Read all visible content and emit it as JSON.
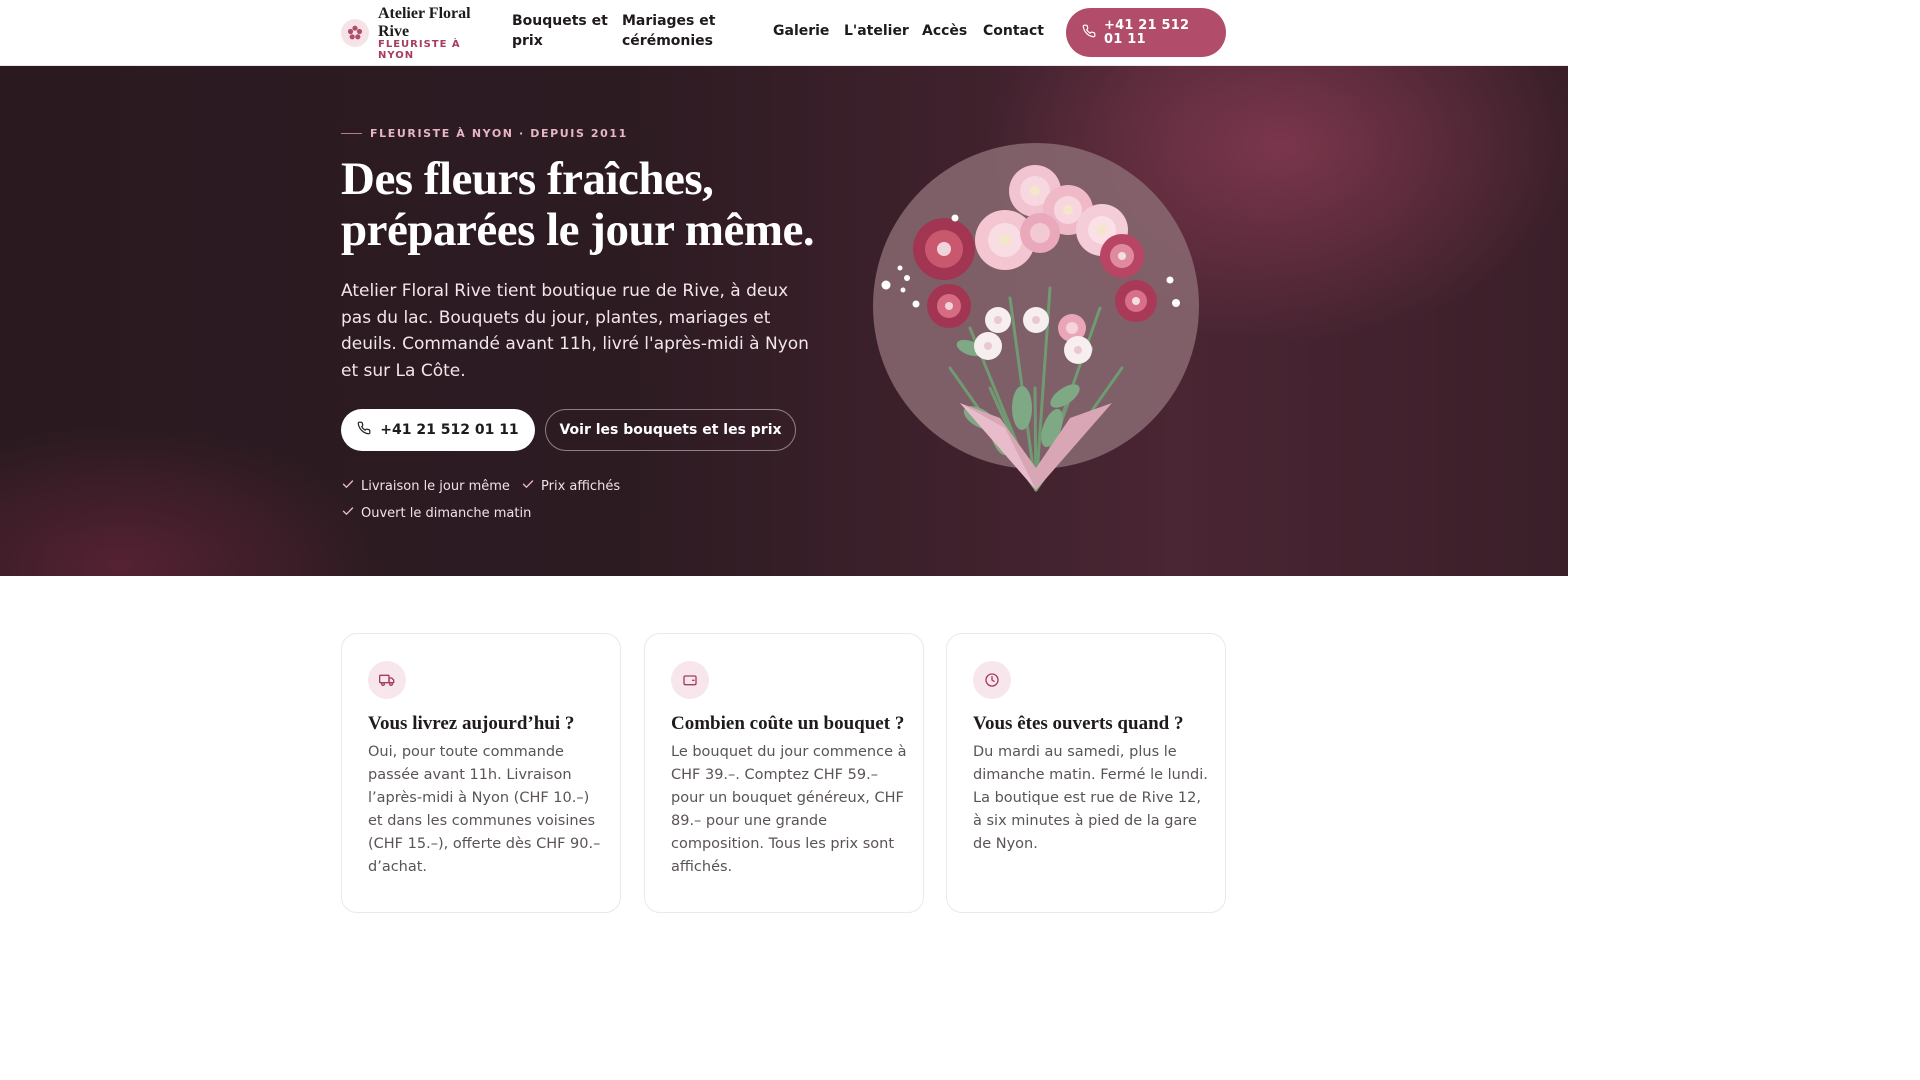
{
  "header": {
    "brand_name": "Atelier Floral Rive",
    "brand_sub": "FLEURISTE À NYON",
    "logo_icon": "flower-icon",
    "nav": [
      {
        "label": "Bouquets et prix"
      },
      {
        "label": "Mariages et cérémonies"
      },
      {
        "label": "Galerie"
      },
      {
        "label": "L'atelier"
      },
      {
        "label": "Accès"
      },
      {
        "label": "Contact"
      }
    ],
    "call_label": "+41 21 512 01 11",
    "call_icon": "phone-icon"
  },
  "hero": {
    "eyebrow": "FLEURISTE À NYON · DEPUIS 2011",
    "title": "Des fleurs fraîches, préparées le jour même.",
    "lead": "Atelier Floral Rive tient boutique rue de Rive, à deux pas du lac. Bouquets du jour, plantes, mariages et deuils. Commandé avant 11h, livré l'après-midi à Nyon et sur La Côte.",
    "primary_cta": "+41 21 512 01 11",
    "secondary_cta": "Voir les bouquets et les prix",
    "perks": [
      "Livraison le jour même",
      "Prix affichés",
      "Ouvert le dimanche matin"
    ],
    "illustration_icon": "bouquet-illustration"
  },
  "faq": [
    {
      "icon": "truck-icon",
      "question": "Vous livrez aujourd’hui ?",
      "answer": "Oui, pour toute commande passée avant 11h. Livraison l’après-midi à Nyon (CHF 10.–) et dans les communes voisines (CHF 15.–), offerte dès CHF 90.– d’achat."
    },
    {
      "icon": "wallet-icon",
      "question": "Combien coûte un bouquet ?",
      "answer": "Le bouquet du jour commence à CHF 39.–. Comptez CHF 59.– pour un bouquet généreux, CHF 89.– pour une grande composition. Tous les prix sont affichés."
    },
    {
      "icon": "clock-icon",
      "question": "Vous êtes ouverts quand ?",
      "answer": "Du mardi au samedi, plus le dimanche matin. Fermé le lundi. La boutique est rue de Rive 12, à six minutes à pied de la gare de Nyon."
    }
  ],
  "colors": {
    "accent": "#b14d6a",
    "hero_bg": "#2d1b22",
    "eyebrow": "#e7b6c5"
  }
}
